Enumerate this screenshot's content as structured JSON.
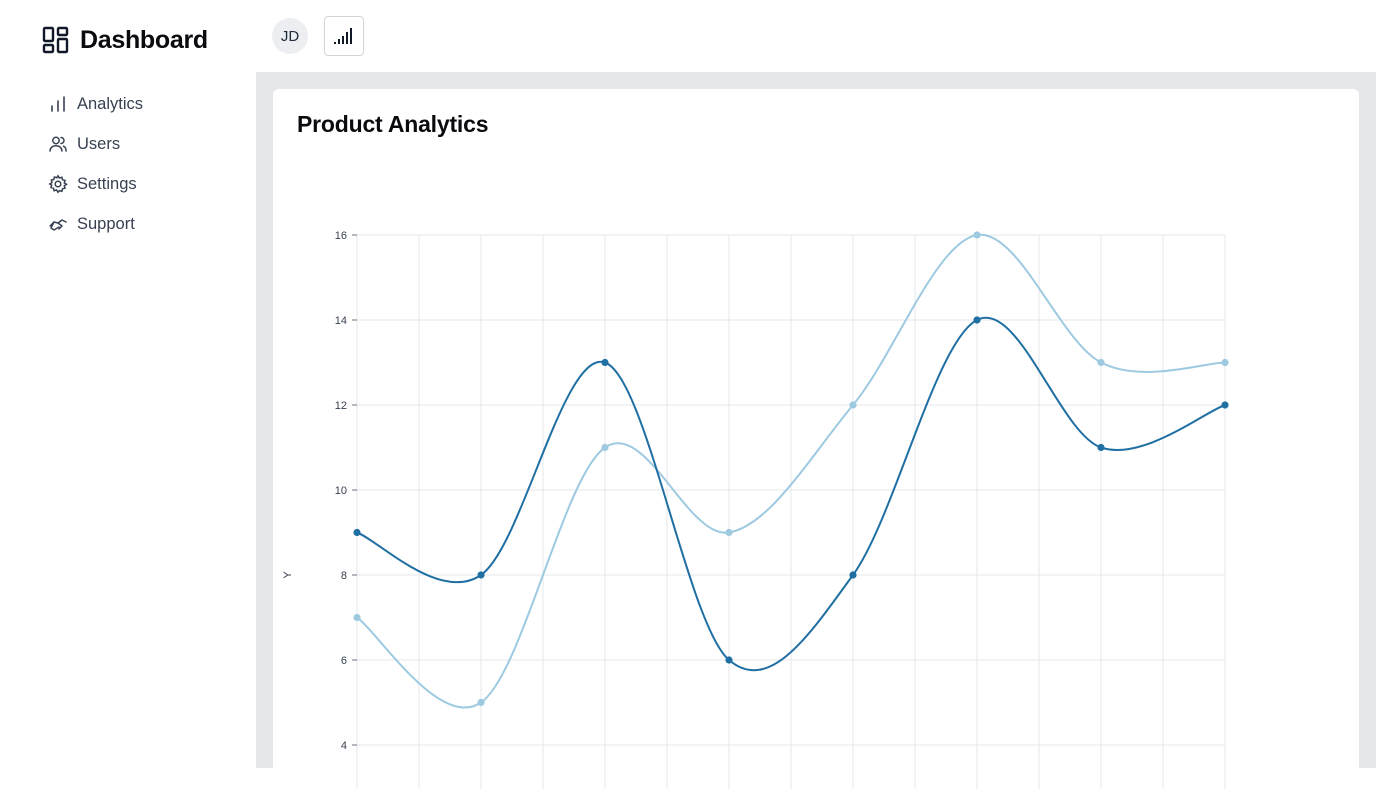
{
  "brand": {
    "title": "Dashboard",
    "icon": "dashboard-grid-icon"
  },
  "sidebar": {
    "items": [
      {
        "label": "Analytics",
        "icon": "bar-chart-icon"
      },
      {
        "label": "Users",
        "icon": "users-icon"
      },
      {
        "label": "Settings",
        "icon": "gear-icon"
      },
      {
        "label": "Support",
        "icon": "handshake-icon"
      }
    ]
  },
  "topbar": {
    "avatar_initials": "JD",
    "signal_icon": "signal-bars-icon"
  },
  "main": {
    "title": "Product Analytics"
  },
  "colors": {
    "series_dark": "#1f6fa3",
    "series_light": "#9ecae1",
    "grid": "#e5e7eb",
    "background": "#e5e7eb"
  },
  "chart_data": {
    "type": "line",
    "title": "",
    "xlabel": "",
    "ylabel": "Y",
    "ylim": [
      4,
      16
    ],
    "yticks": [
      4,
      6,
      8,
      10,
      12,
      14,
      16
    ],
    "grid": true,
    "smooth": true,
    "x": [
      0,
      1,
      2,
      3,
      4,
      5,
      6,
      7
    ],
    "series": [
      {
        "values": [
          9,
          8,
          13,
          6,
          8,
          14,
          11,
          12
        ],
        "color": "#1f6fa3"
      },
      {
        "values": [
          7,
          5,
          11,
          9,
          12,
          16,
          13,
          13
        ],
        "color": "#9ecae1"
      }
    ]
  }
}
